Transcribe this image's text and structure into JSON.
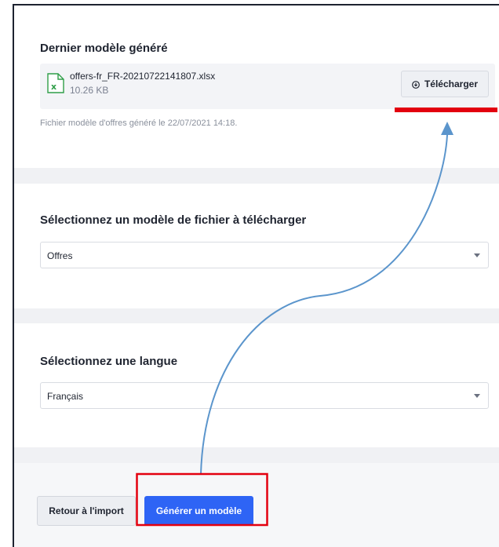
{
  "last_template": {
    "heading": "Dernier modèle généré",
    "file_name": "offers-fr_FR-20210722141807.xlsx",
    "file_size": "10.26 KB",
    "download_label": "Télécharger",
    "caption": "Fichier modèle d'offres généré le 22/07/2021 14:18."
  },
  "template_type": {
    "heading": "Sélectionnez un modèle de fichier à télécharger",
    "selected": "Offres"
  },
  "language": {
    "heading": "Sélectionnez une langue",
    "selected": "Français"
  },
  "footer": {
    "back_label": "Retour à l'import",
    "generate_label": "Générer un modèle"
  },
  "colors": {
    "primary": "#2e64f5",
    "annotation_red": "#e3000f",
    "annotation_arrow": "#5b95cc",
    "excel_green": "#2f9e48"
  },
  "icons": {
    "file": "excel-file-icon",
    "download": "download-circle-icon",
    "dropdown": "chevron-down-icon"
  }
}
